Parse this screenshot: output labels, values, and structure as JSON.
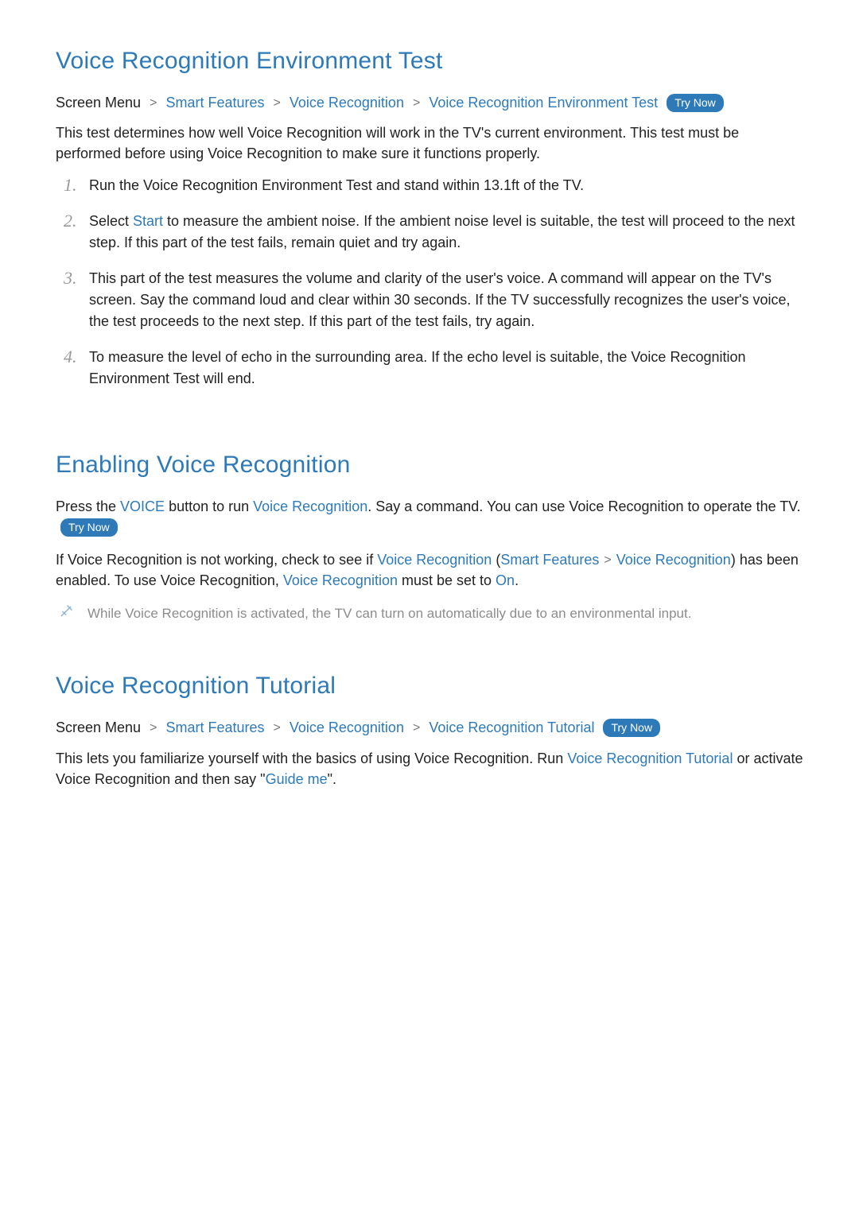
{
  "labels": {
    "try_now": "Try Now",
    "screen_menu": "Screen Menu",
    "chevron": ">"
  },
  "section1": {
    "title": "Voice Recognition Environment Test",
    "breadcrumb": {
      "p1": "Smart Features",
      "p2": "Voice Recognition",
      "p3": "Voice Recognition Environment Test"
    },
    "intro": "This test determines how well Voice Recognition will work in the TV's current environment. This test must be performed before using Voice Recognition to make sure it functions properly.",
    "items": {
      "i1": "Run the Voice Recognition Environment Test and stand within 13.1ft of the TV.",
      "i2a": "Select ",
      "i2hl": "Start",
      "i2b": " to measure the ambient noise. If the ambient noise level is suitable, the test will proceed to the next step. If this part of the test fails, remain quiet and try again.",
      "i3": "This part of the test measures the volume and clarity of the user's voice. A command will appear on the TV's screen. Say the command loud and clear within 30 seconds. If the TV successfully recognizes the user's voice, the test proceeds to the next step. If this part of the test fails, try again.",
      "i4": "To measure the level of echo in the surrounding area. If the echo level is suitable, the Voice Recognition Environment Test will end."
    }
  },
  "section2": {
    "title": "Enabling Voice Recognition",
    "p1a": "Press the ",
    "p1hl1": "VOICE",
    "p1b": " button to run ",
    "p1hl2": "Voice Recognition",
    "p1c": ". Say a command. You can use Voice Recognition to operate the TV. ",
    "p2a": "If Voice Recognition is not working, check to see if ",
    "p2hl1": "Voice Recognition",
    "p2paren_open": " (",
    "p2hl2": "Smart Features",
    "p2hl3": "Voice Recognition",
    "p2paren_close": ")",
    "p2b": " has been enabled. To use Voice Recognition, ",
    "p2hl4": "Voice Recognition",
    "p2c": " must be set to ",
    "p2hl5": "On",
    "p2d": ".",
    "note": "While Voice Recognition is activated, the TV can turn on automatically due to an environmental input."
  },
  "section3": {
    "title": "Voice Recognition Tutorial",
    "breadcrumb": {
      "p1": "Smart Features",
      "p2": "Voice Recognition",
      "p3": "Voice Recognition Tutorial"
    },
    "p1a": "This lets you familiarize yourself with the basics of using Voice Recognition. Run ",
    "p1hl1": "Voice Recognition Tutorial",
    "p1b": " or activate Voice Recognition and then say \"",
    "p1hl2": "Guide me",
    "p1c": "\"."
  }
}
